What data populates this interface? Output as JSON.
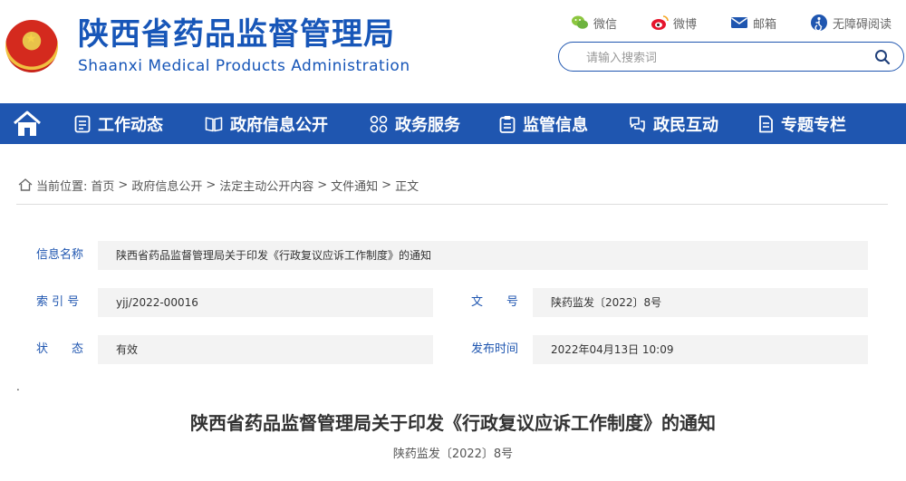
{
  "header": {
    "title_cn": "陕西省药品监督管理局",
    "title_en": "Shaanxi Medical Products Administration",
    "links": [
      {
        "label": "微信",
        "icon": "wechat-icon"
      },
      {
        "label": "微博",
        "icon": "weibo-icon"
      },
      {
        "label": "邮箱",
        "icon": "mail-icon"
      },
      {
        "label": "无障碍阅读",
        "icon": "accessibility-icon"
      }
    ],
    "search_placeholder": "请输入搜索词"
  },
  "nav": {
    "items": [
      {
        "label": "工作动态"
      },
      {
        "label": "政府信息公开"
      },
      {
        "label": "政务服务"
      },
      {
        "label": "监管信息"
      },
      {
        "label": "政民互动"
      },
      {
        "label": "专题专栏"
      }
    ]
  },
  "breadcrumb": {
    "prefix": "当前位置:",
    "items": [
      "首页",
      "政府信息公开",
      "法定主动公开内容",
      "文件通知",
      "正文"
    ],
    "sep": ">"
  },
  "info": {
    "name_label": "信息名称",
    "name_value": "陕西省药品监督管理局关于印发《行政复议应诉工作制度》的通知",
    "index_label": "索 引 号",
    "index_value": "yjj/2022-00016",
    "docno_label": "文　　号",
    "docno_value": "陕药监发〔2022〕8号",
    "status_label": "状　　态",
    "status_value": "有效",
    "date_label": "发布时间",
    "date_value": "2022年04月13日 10:09"
  },
  "article": {
    "marker": ".",
    "title": "陕西省药品监督管理局关于印发《行政复议应诉工作制度》的通知",
    "doc_number": "陕药监发〔2022〕8号"
  },
  "colors": {
    "brand": "#1f56b0",
    "title": "#1756b8"
  }
}
